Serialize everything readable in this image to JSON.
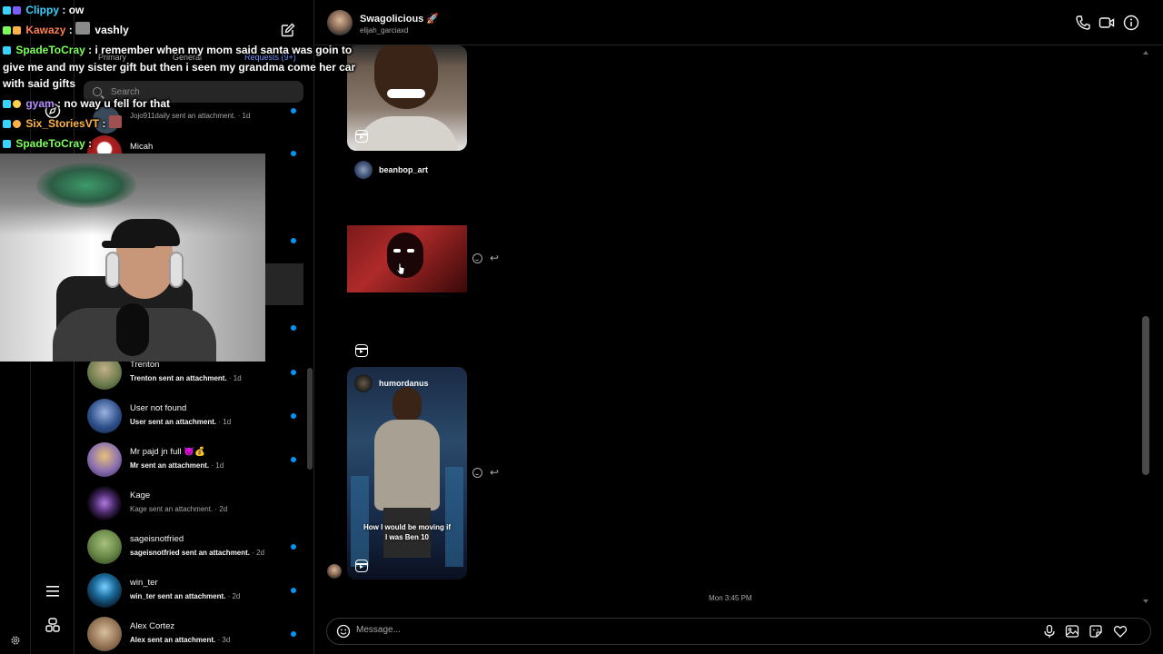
{
  "chat_overlay": {
    "messages": [
      {
        "user": "Clippy",
        "user_color": "#3ad3ff",
        "text": ": ow"
      },
      {
        "user": "Kawazy",
        "user_color": "#ff7f50",
        "text": ":",
        "mention": "vashly"
      },
      {
        "user": "SpadeToCray",
        "user_color": "#7cff5a",
        "text": ": i remember when my mom said santa was goin to"
      },
      {
        "continuation": "give me and my sister gift but then i seen my grandma come her car"
      },
      {
        "continuation": "with said gifts"
      },
      {
        "user": "gyam",
        "user_color": "#b58cff",
        "text": ": no way u fell for that"
      },
      {
        "user": "Six_StoriesVT",
        "user_color": "#ffb347",
        "text": ":"
      },
      {
        "user": "SpadeToCray",
        "user_color": "#7cff5a",
        "text": ":"
      }
    ]
  },
  "inbox": {
    "tabs": {
      "primary": "Primary",
      "general": "General",
      "requests": "Requests (9+)"
    },
    "search_placeholder": "Search",
    "conversations": [
      {
        "name": "",
        "preview": "Jojo911daily sent an attachment.",
        "time": "· 1d",
        "unread": true,
        "avatar_color": "#3a4a5a"
      },
      {
        "name": "Micah",
        "preview": "",
        "time": "",
        "unread": true,
        "avatar_color": "#b02020"
      },
      {
        "name": "Trenton",
        "preview": "Trenton sent an attachment.",
        "time": "· 1d",
        "unread": true,
        "avatar_color": "#6a7a4a"
      },
      {
        "name": "User not found",
        "preview": "User sent an attachment.",
        "time": "· 1d",
        "unread": true,
        "avatar_color": "#2d4f8a"
      },
      {
        "name": "Mr pajd jn full 😈💰",
        "preview": "Mr sent an attachment.",
        "time": "· 1d",
        "unread": true,
        "avatar_color": "#8a6fb0"
      },
      {
        "name": "Kage",
        "preview": "Kage sent an attachment.",
        "time": "· 2d",
        "unread": false,
        "avatar_color": "#4a2a6a"
      },
      {
        "name": "sageisnotfried",
        "preview": "sageisnotfried sent an attachment.",
        "time": "· 2d",
        "unread": true,
        "avatar_color": "#6a8a4a"
      },
      {
        "name": "win_ter",
        "preview": "win_ter sent an attachment.",
        "time": "· 2d",
        "unread": true,
        "avatar_color": "#1a6a9a"
      },
      {
        "name": "Alex Cortez",
        "preview": "Alex sent an attachment.",
        "time": "· 3d",
        "unread": true,
        "avatar_color": "#9a7a5a"
      }
    ]
  },
  "thread": {
    "contact_name": "Swagolicious 🚀",
    "contact_username": "elijah_garciaxd",
    "shared_users": [
      "beanbop_art",
      "humordanus"
    ],
    "reel_caption": "How I would be moving if I was Ben 10",
    "timestamp": "Mon 3:45 PM",
    "message_placeholder": "Message..."
  },
  "icons": {
    "rail": [
      "compass-icon",
      "menu-icon",
      "threads-icon",
      "settings-icon"
    ],
    "header": [
      "phone-icon",
      "video-icon",
      "info-icon"
    ],
    "composer": [
      "emoji-icon",
      "microphone-icon",
      "image-icon",
      "sticker-icon",
      "heart-icon"
    ]
  },
  "colors": {
    "accent": "#0095f6",
    "background": "#000000",
    "divider": "#262626"
  }
}
